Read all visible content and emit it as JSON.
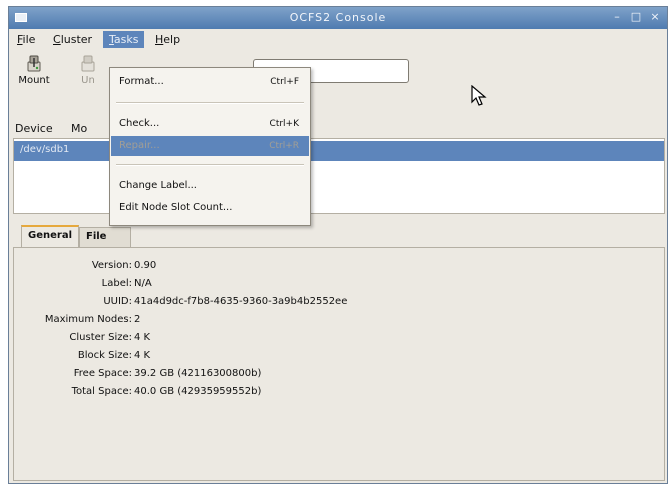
{
  "window": {
    "title": "OCFS2 Console"
  },
  "menubar": {
    "items": [
      {
        "label": "File",
        "mnemonic": "F",
        "rest": "ile"
      },
      {
        "label": "Cluster",
        "mnemonic": "C",
        "rest": "luster"
      },
      {
        "label": "Tasks",
        "mnemonic": "T",
        "rest": "asks"
      },
      {
        "label": "Help",
        "mnemonic": "H",
        "rest": "elp"
      }
    ]
  },
  "toolbar": {
    "mount_label": "Mount",
    "unmount_label": "Un"
  },
  "list": {
    "headers": [
      "Device",
      "Mo"
    ],
    "rows": [
      {
        "device": "/dev/sdb1"
      }
    ]
  },
  "tasks_menu": {
    "format": {
      "label": "Format...",
      "accel": "Ctrl+F"
    },
    "check": {
      "label": "Check...",
      "accel": "Ctrl+K"
    },
    "repair": {
      "label": "Repair...",
      "accel": "Ctrl+R"
    },
    "change_label": {
      "label": "Change Label..."
    },
    "edit_node_slot": {
      "label": "Edit Node Slot Count..."
    }
  },
  "tabs": [
    {
      "label": "General"
    },
    {
      "label": "File Listing"
    }
  ],
  "general": {
    "props": [
      {
        "key": "Version:",
        "value": "0.90"
      },
      {
        "key": "Label:",
        "value": "N/A"
      },
      {
        "key": "UUID:",
        "value": "41a4d9dc-f7b8-4635-9360-3a9b4b2552ee"
      },
      {
        "key": "Maximum Nodes:",
        "value": "2"
      },
      {
        "key": "Cluster Size:",
        "value": "4 K"
      },
      {
        "key": "Block Size:",
        "value": "4 K"
      },
      {
        "key": "Free Space:",
        "value": "39.2 GB (42116300800b)"
      },
      {
        "key": "Total Space:",
        "value": "40.0 GB (42935959552b)"
      }
    ]
  },
  "colors": {
    "titlebar": "#5d85bb",
    "selection": "#5d85bb",
    "tab_accent": "#e6a93d",
    "window_bg": "#ece9e2"
  },
  "icons": [
    "mount-icon",
    "unmount-icon",
    "pointer-cursor-icon"
  ]
}
